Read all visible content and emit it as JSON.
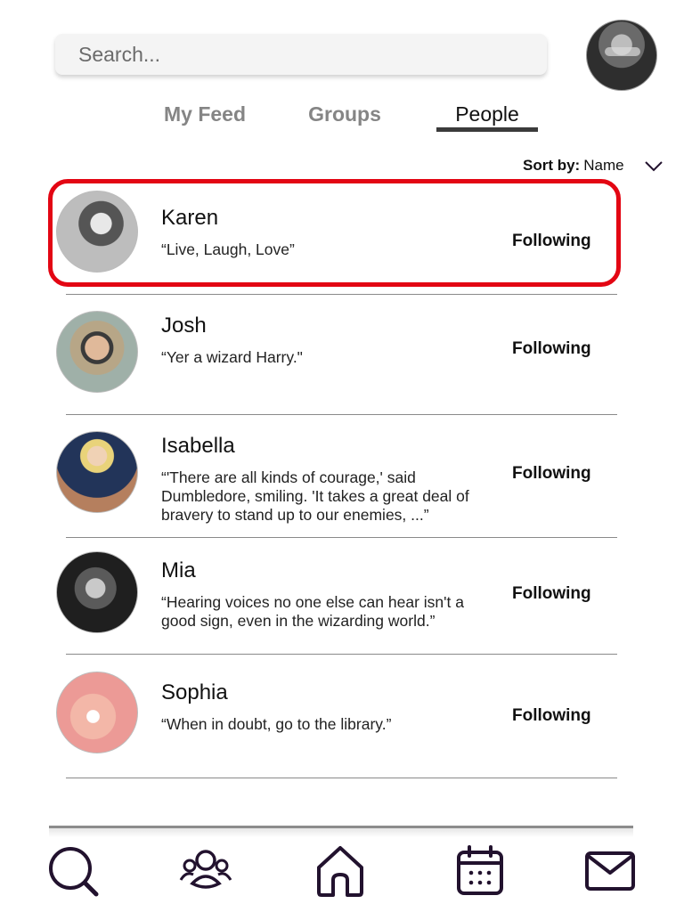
{
  "search": {
    "placeholder": "Search..."
  },
  "profile": {
    "icon": "user-avatar"
  },
  "tabs": [
    {
      "label": "My Feed",
      "active": false
    },
    {
      "label": "Groups",
      "active": false
    },
    {
      "label": "People",
      "active": true
    }
  ],
  "sort": {
    "label": "Sort by:",
    "value": "Name",
    "icon": "chevron-down-icon"
  },
  "people": [
    {
      "name": "Karen",
      "quote": "“Live, Laugh, Love”",
      "status": "Following",
      "highlighted": true
    },
    {
      "name": "Josh",
      "quote": "“Yer a wizard Harry.\"",
      "status": "Following",
      "highlighted": false
    },
    {
      "name": "Isabella",
      "quote": "“'There are all kinds of courage,' said Dumbledore, smiling. 'It takes a great deal of bravery to stand up to our enemies, ...”",
      "status": "Following",
      "highlighted": false
    },
    {
      "name": "Mia",
      "quote": "“Hearing voices no one else can hear isn't a good sign, even in the wizarding world.”",
      "status": "Following",
      "highlighted": false
    },
    {
      "name": "Sophia",
      "quote": "“When in doubt, go to the library.”",
      "status": "Following",
      "highlighted": false
    }
  ],
  "colors": {
    "highlight": "#e30613",
    "nav_icon": "#22122e"
  },
  "bottom_nav": [
    {
      "icon": "search-icon"
    },
    {
      "icon": "groups-icon"
    },
    {
      "icon": "home-icon"
    },
    {
      "icon": "calendar-icon"
    },
    {
      "icon": "mail-icon"
    }
  ]
}
